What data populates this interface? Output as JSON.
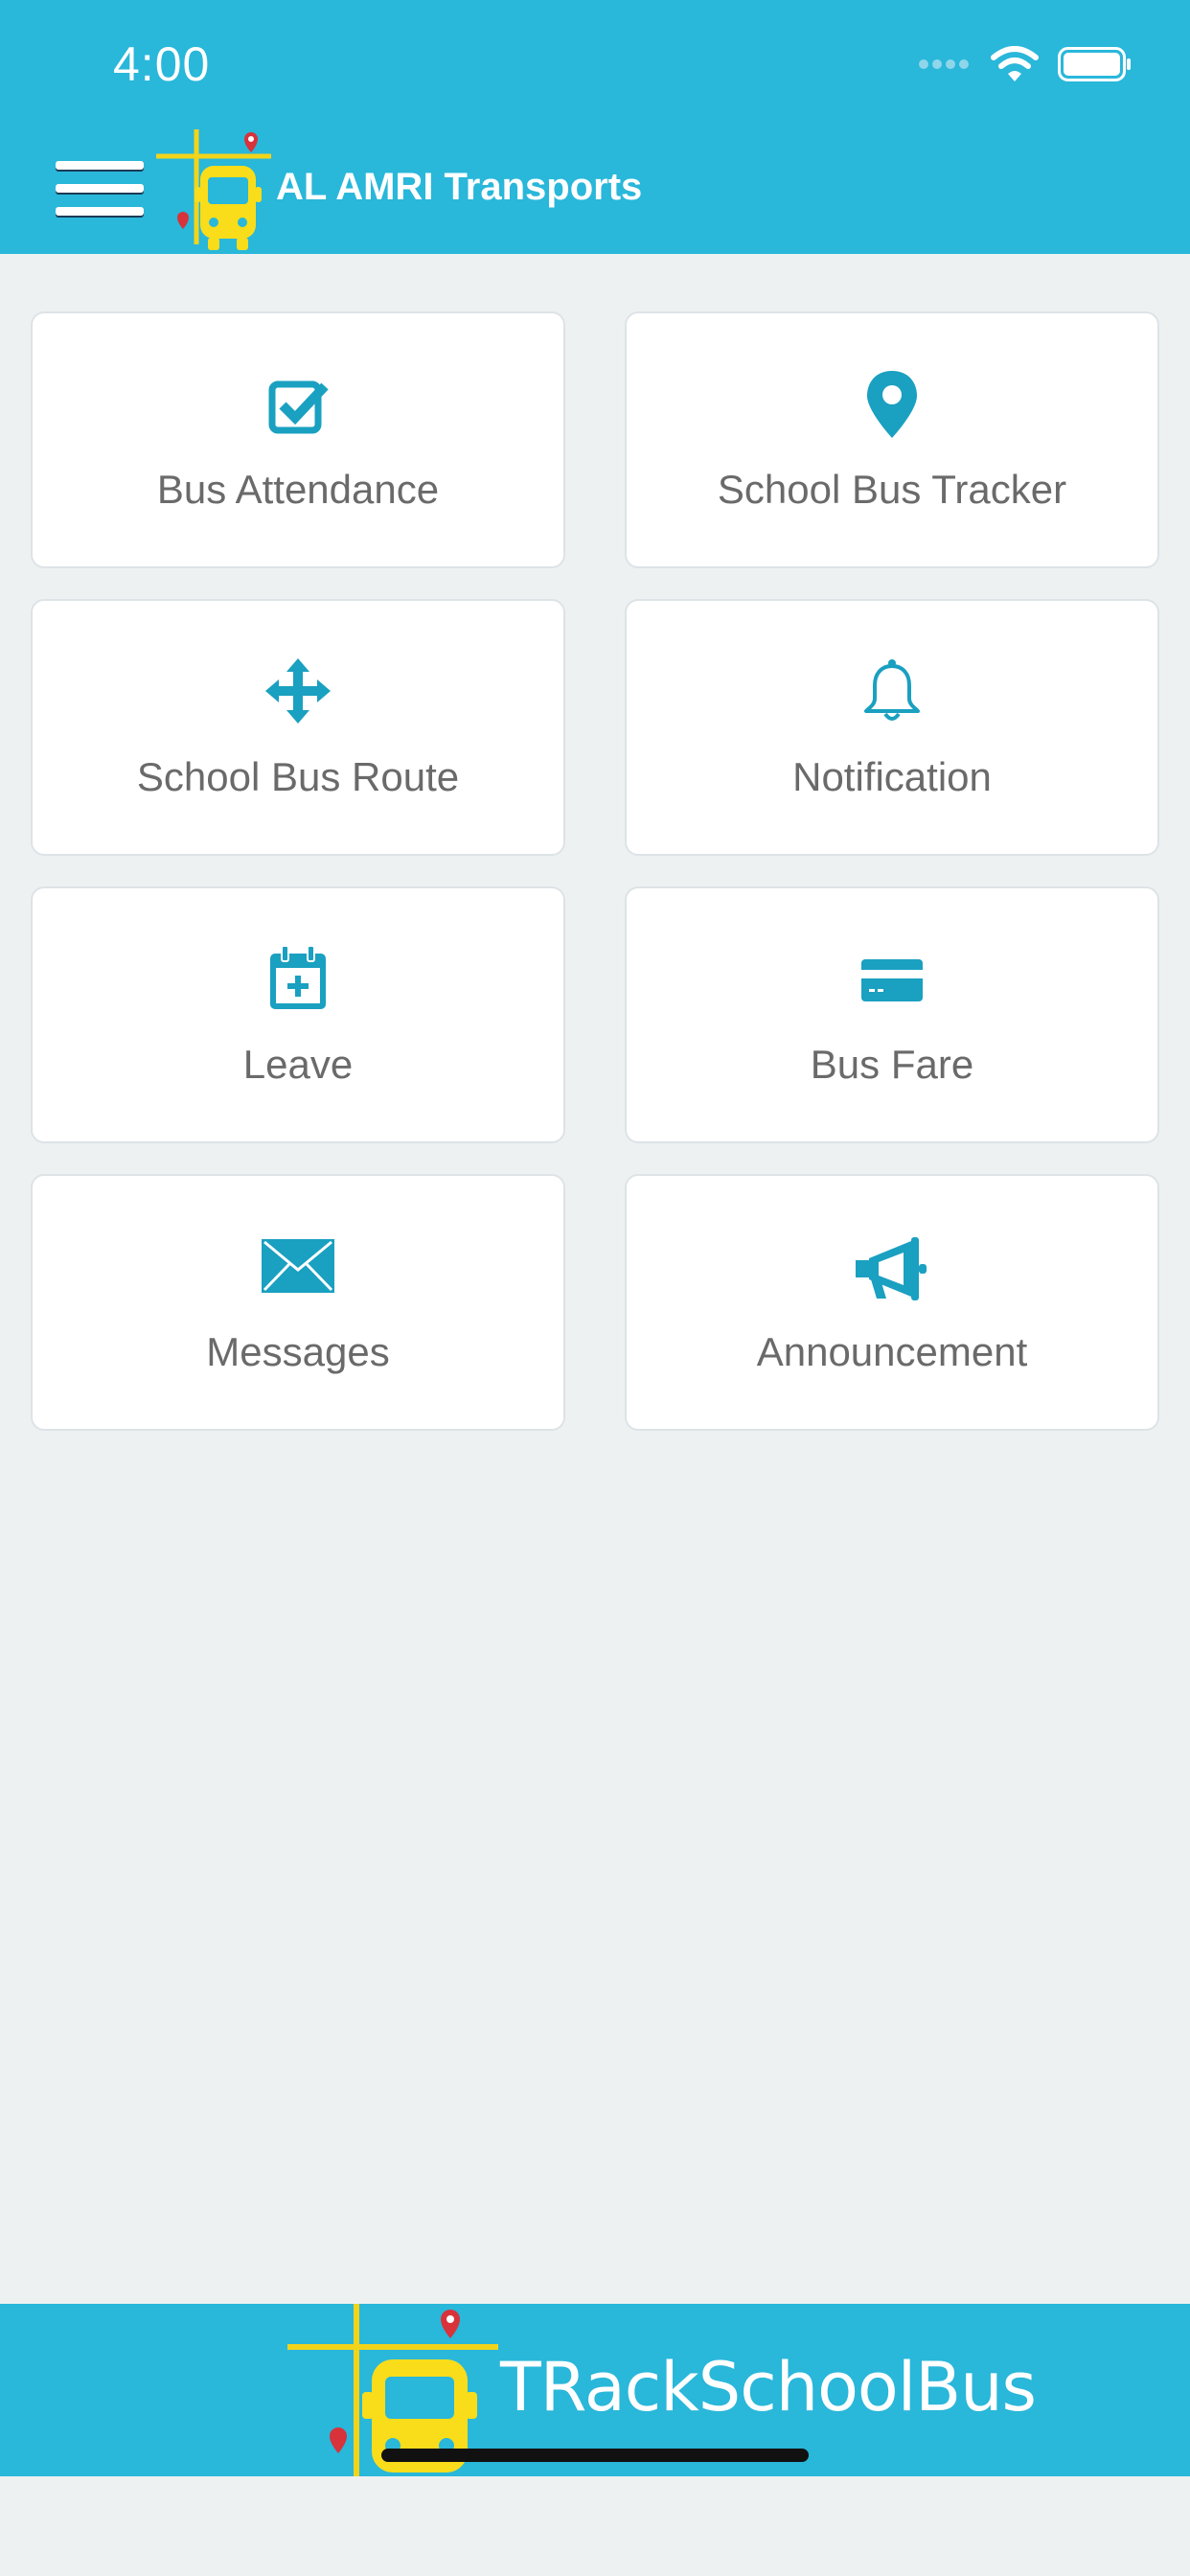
{
  "status_bar": {
    "time": "4:00"
  },
  "app_bar": {
    "title": "AL AMRI Transports"
  },
  "menu": [
    {
      "label": "Bus Attendance",
      "icon": "checkbox-icon"
    },
    {
      "label": "School Bus Tracker",
      "icon": "map-pin-icon"
    },
    {
      "label": "School Bus Route",
      "icon": "move-arrows-icon"
    },
    {
      "label": "Notification",
      "icon": "bell-icon"
    },
    {
      "label": "Leave",
      "icon": "calendar-plus-icon"
    },
    {
      "label": "Bus Fare",
      "icon": "credit-card-icon"
    },
    {
      "label": "Messages",
      "icon": "envelope-icon"
    },
    {
      "label": "Announcement",
      "icon": "megaphone-icon"
    }
  ],
  "footer": {
    "brand": "TRackSchoolBus"
  },
  "colors": {
    "header": "#29b7da",
    "icon": "#1aa0c0",
    "label": "#6a6a6a",
    "background": "#eef1f2",
    "bus": "#f9dd1a"
  }
}
